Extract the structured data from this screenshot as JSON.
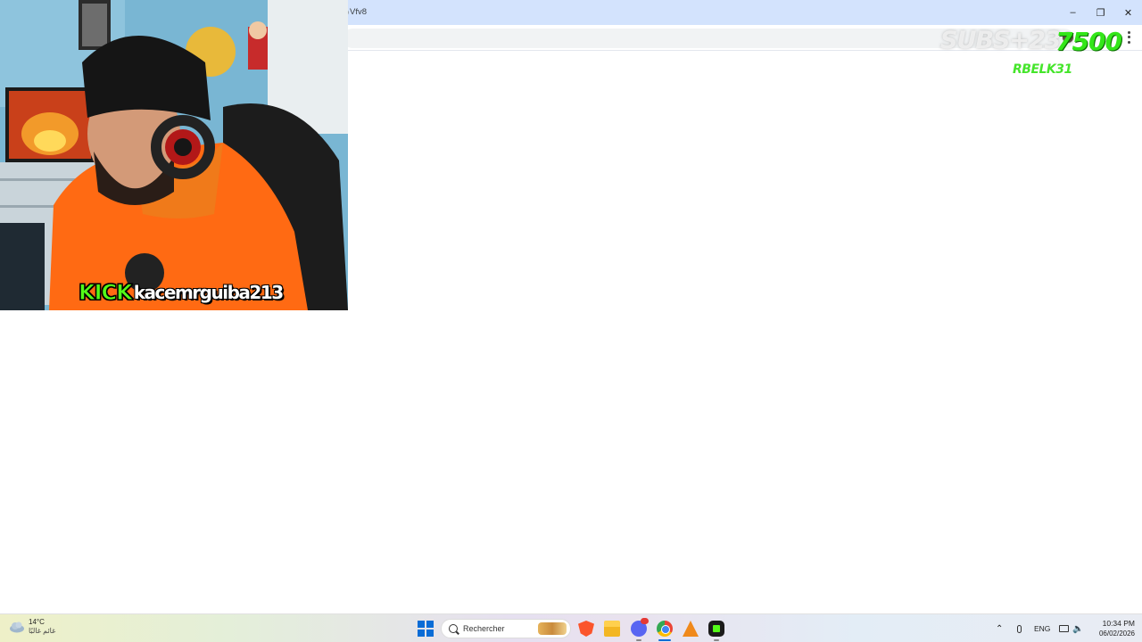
{
  "browser": {
    "address_text": "Vfv8",
    "window_controls": {
      "minimize_icon": "minimize-icon",
      "restore_icon": "restore-icon",
      "close_icon": "close-icon"
    },
    "menu_icon": "kebab-menu-icon",
    "colors": {
      "titlebar": "#d3e3fd"
    }
  },
  "overlay": {
    "subs_counter": "SUBS+23",
    "goal_counter": "7500",
    "last_sub": "RBELK31",
    "colors": {
      "goal": "#33e619",
      "last_sub": "#45e52b"
    }
  },
  "webcam": {
    "platform_label": "KICK",
    "username": "kacemrguiba213",
    "colors": {
      "kick_green": "#53fc18"
    }
  },
  "taskbar": {
    "weather": {
      "temp": "14°C",
      "description": "غائم غالبًا",
      "icon": "cloudy-weather-icon"
    },
    "search_placeholder": "Rechercher",
    "apps": [
      "brave-icon",
      "file-explorer-icon",
      "discord-icon",
      "chrome-icon",
      "gimp-icon",
      "kick-app-icon"
    ],
    "tray": {
      "language": "ENG",
      "time": "10:34 PM",
      "date": "06/02/2026"
    }
  }
}
